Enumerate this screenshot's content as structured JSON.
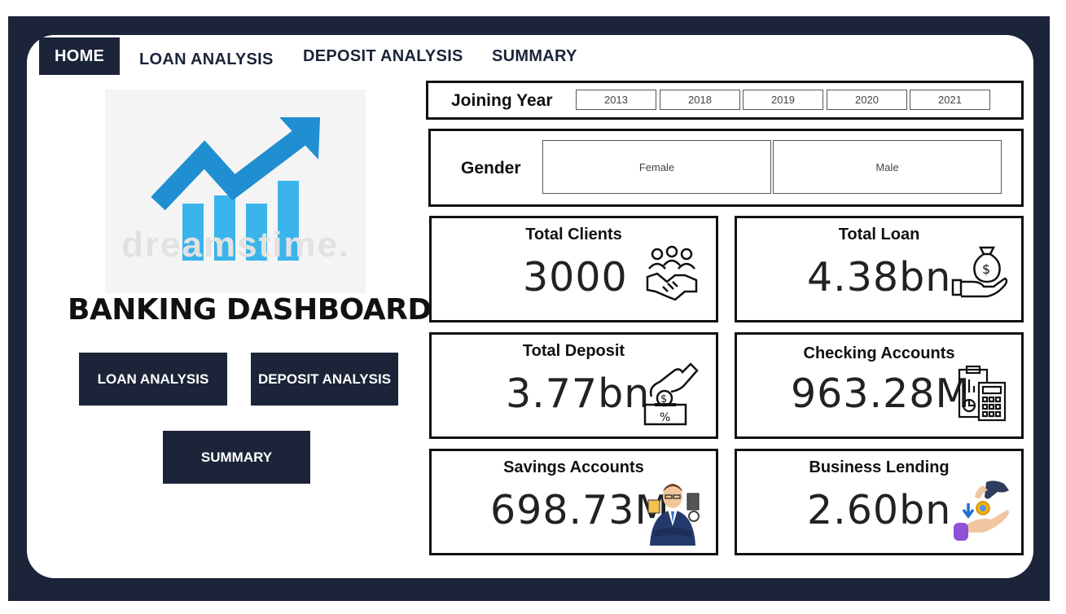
{
  "nav": {
    "home": "HOME",
    "loan_analysis": "LOAN ANALYSIS",
    "deposit_analysis": "DEPOSIT ANALYSIS",
    "summary": "SUMMARY"
  },
  "logo": {
    "watermark": "dreamstime."
  },
  "title": "BANKING DASHBOARD",
  "buttons": {
    "loan_analysis": "LOAN ANALYSIS",
    "deposit_analysis": "DEPOSIT ANALYSIS",
    "summary": "SUMMARY"
  },
  "filters": {
    "joining_year": {
      "label": "Joining Year",
      "options": [
        "2013",
        "2018",
        "2019",
        "2020",
        "2021"
      ]
    },
    "gender": {
      "label": "Gender",
      "options": [
        "Female",
        "Male"
      ]
    }
  },
  "kpis": [
    {
      "title": "Total Clients",
      "value": "3000",
      "icon": "handshake-people-icon"
    },
    {
      "title": "Total Loan",
      "value": "4.38bn",
      "icon": "money-bag-hand-icon"
    },
    {
      "title": "Total Deposit",
      "value": "3.77bn",
      "icon": "deposit-coin-box-icon"
    },
    {
      "title": "Checking Accounts",
      "value": "963.28M",
      "icon": "clipboard-calculator-icon"
    },
    {
      "title": "Savings Accounts",
      "value": "698.73M",
      "icon": "banker-businessman-icon"
    },
    {
      "title": "Business Lending",
      "value": "2.60bn",
      "icon": "hand-coin-lending-icon"
    }
  ],
  "colors": {
    "navy": "#1b2438",
    "accent_blue": "#1f8fd1",
    "light_blue": "#3bb4ec"
  }
}
